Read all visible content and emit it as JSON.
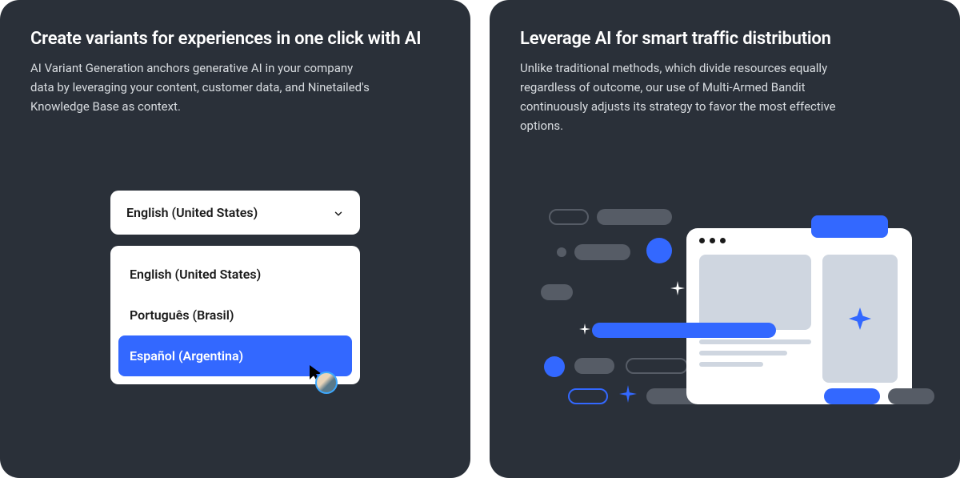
{
  "left_card": {
    "title": "Create variants for experiences in one click with AI",
    "description": "AI Variant Generation anchors generative AI in your company data by leveraging your content, customer data, and Ninetailed's Knowledge Base as context.",
    "dropdown": {
      "selected_label": "English (United States)",
      "options": [
        "English (United States)",
        "Português (Brasil)",
        "Español (Argentina)"
      ],
      "highlighted_index": 2
    }
  },
  "right_card": {
    "title": "Leverage AI for smart traffic distribution",
    "description": "Unlike traditional methods, which divide resources equally regardless of outcome, our use of Multi-Armed Bandit continuously adjusts its strategy to favor the most effective options."
  },
  "colors": {
    "card_bg": "#2a3039",
    "accent_blue": "#3368ff",
    "muted_grey": "#565c66",
    "pale_grey": "#cfd6e0"
  }
}
